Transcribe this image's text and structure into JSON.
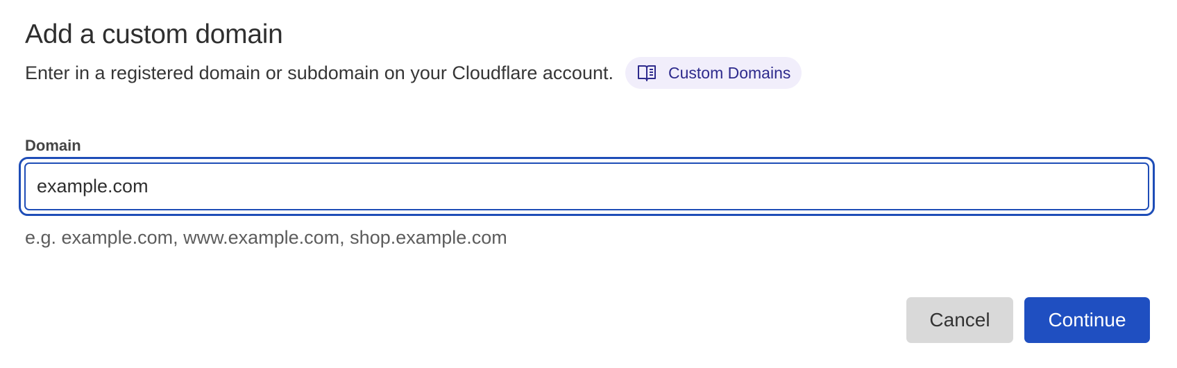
{
  "dialog": {
    "title": "Add a custom domain",
    "subtitle": "Enter in a registered domain or subdomain on your Cloudflare account.",
    "doc_link": {
      "icon": "book-icon",
      "label": "Custom Domains"
    }
  },
  "domain_field": {
    "label": "Domain",
    "value": "example.com",
    "placeholder": "",
    "hint": "e.g. example.com, www.example.com, shop.example.com"
  },
  "actions": {
    "cancel_label": "Cancel",
    "continue_label": "Continue"
  },
  "colors": {
    "accent": "#1f4fc1",
    "focus_ring": "#1e4db7",
    "link_bg": "#f1eefb",
    "link_text": "#2d2a8c",
    "cancel_bg": "#d9d9d9"
  }
}
